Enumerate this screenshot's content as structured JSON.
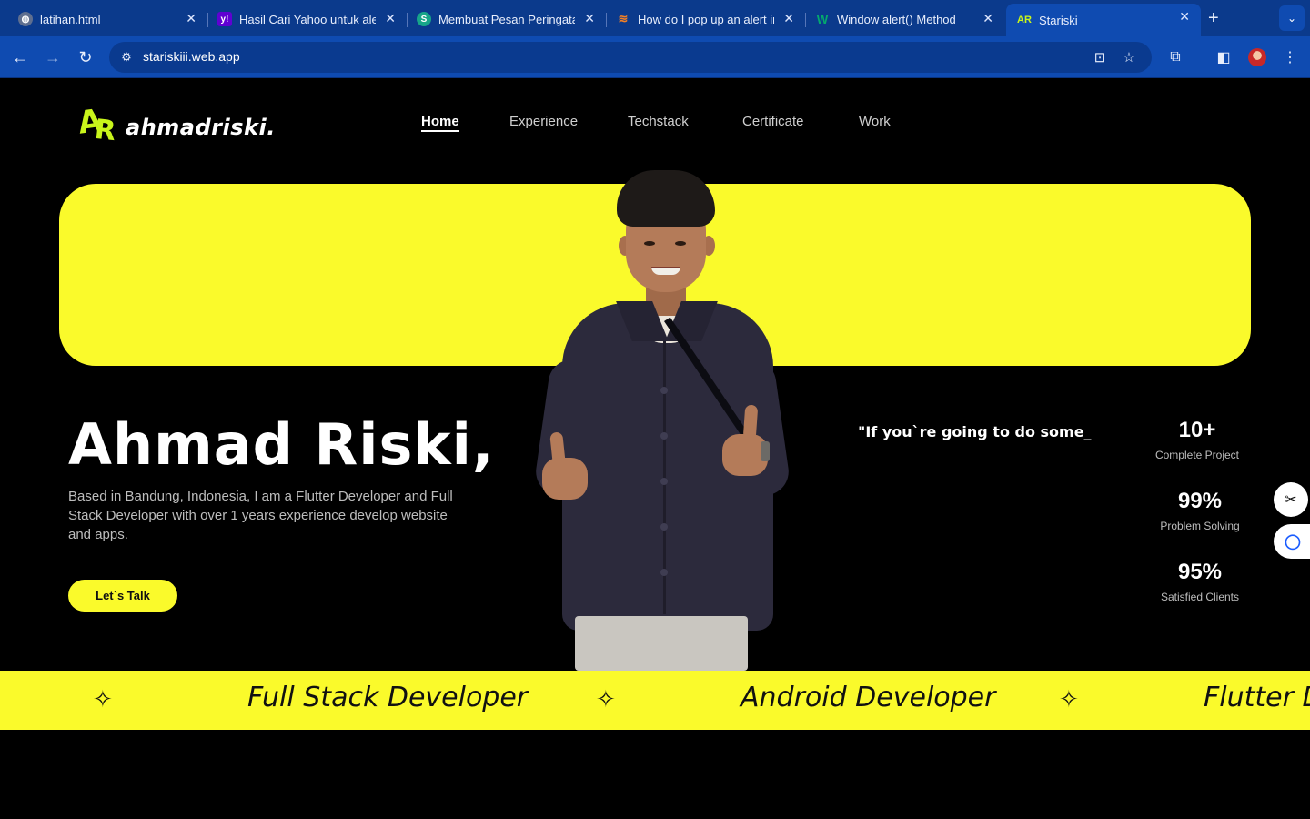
{
  "browser": {
    "tabs": [
      {
        "title": "latihan.html",
        "favicon": "globe-icon",
        "color": "#5f6f8f"
      },
      {
        "title": "Hasil Cari Yahoo untuk alert",
        "favicon": "yahoo-icon",
        "color": "#6001d2"
      },
      {
        "title": "Membuat Pesan Peringatan",
        "favicon": "s-logo-icon",
        "color": "#17a589"
      },
      {
        "title": "How do I pop up an alert in",
        "favicon": "stackoverflow-icon",
        "color": "#f48024"
      },
      {
        "title": "Window alert() Method",
        "favicon": "w3schools-icon",
        "color": "#04aa6d"
      },
      {
        "title": "Stariski",
        "favicon": "ar-logo-icon",
        "color": "#c9f51b"
      }
    ],
    "url": "stariskiii.web.app"
  },
  "site": {
    "logo_text": "ahmadriski.",
    "logo_mark": [
      "A",
      "R"
    ],
    "nav": [
      "Home",
      "Experience",
      "Techstack",
      "Certificate",
      "Work"
    ],
    "hero": {
      "name": "Ahmad Riski,",
      "description": "Based in Bandung, Indonesia, I am a Flutter Developer and Full Stack Developer with over 1 years experience develop website and apps.",
      "cta": "Let`s Talk",
      "quote": "\"If you`re going to do some_"
    },
    "stats": [
      {
        "value": "10+",
        "label": "Complete Project"
      },
      {
        "value": "99%",
        "label": "Problem Solving"
      },
      {
        "value": "95%",
        "label": "Satisfied Clients"
      }
    ],
    "marquee": [
      "Full Stack Developer",
      "Android Developer",
      "Flutter D"
    ],
    "accent": "#fafa2b",
    "logo_color": "#c9f51b"
  }
}
